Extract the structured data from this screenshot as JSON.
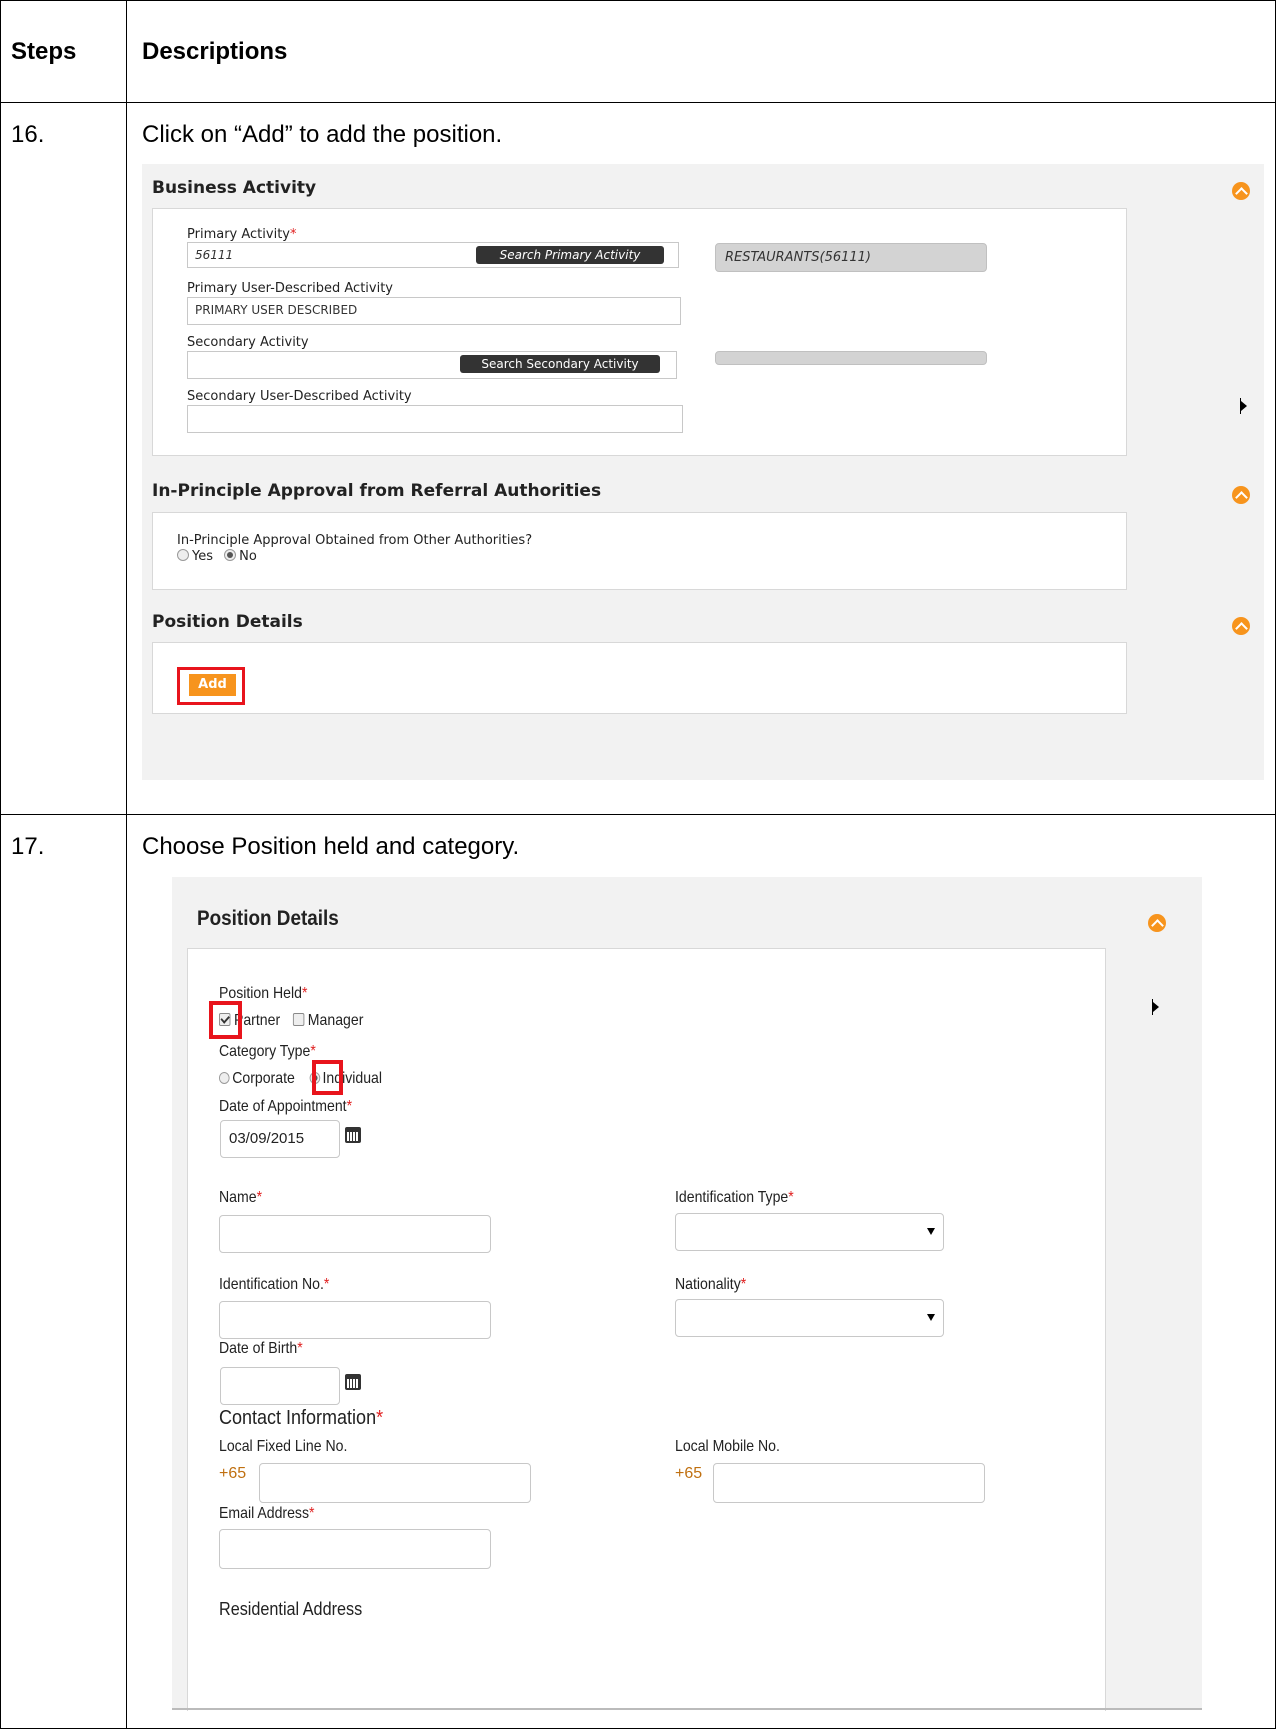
{
  "header": {
    "steps": "Steps",
    "descriptions": "Descriptions"
  },
  "step16": {
    "number": "16.",
    "instruction": "Click on “Add” to add the position.",
    "business_activity": {
      "title": "Business Activity",
      "primary_activity_label": "Primary Activity",
      "primary_activity_value": "56111",
      "search_primary_button": "Search Primary Activity",
      "primary_result": "RESTAURANTS(56111)",
      "primary_user_desc_label": "Primary User-Described Activity",
      "primary_user_desc_value": "PRIMARY USER DESCRIBED",
      "secondary_activity_label": "Secondary Activity",
      "search_secondary_button": "Search Secondary Activity",
      "secondary_user_desc_label": "Secondary User-Described Activity"
    },
    "approval": {
      "title": "In-Principle Approval from Referral Authorities",
      "question": "In-Principle Approval Obtained from Other Authorities?",
      "yes": "Yes",
      "no": "No",
      "selected": "No"
    },
    "position": {
      "title": "Position Details",
      "add_button": "Add"
    },
    "colors": {
      "accent": "#f7941d",
      "highlight": "#e8141c"
    }
  },
  "step17": {
    "number": "17.",
    "instruction": "Choose Position held and category.",
    "section_title": "Position Details",
    "position_held_label": "Position Held",
    "partner": "Partner",
    "manager": "Manager",
    "category_type_label": "Category Type",
    "corporate": "Corporate",
    "individual": "Individual",
    "date_of_appointment_label": "Date of Appointment",
    "date_of_appointment_value": "03/09/2015",
    "name_label": "Name",
    "identification_type_label": "Identification Type",
    "identification_no_label": "Identification No.",
    "nationality_label": "Nationality",
    "date_of_birth_label": "Date of Birth",
    "contact_info_heading": "Contact Information",
    "local_fixed_line_label": "Local Fixed Line No.",
    "local_mobile_label": "Local Mobile No.",
    "country_code": "+65",
    "email_label": "Email Address",
    "residential_address_heading": "Residential Address",
    "required_mark": "*"
  }
}
